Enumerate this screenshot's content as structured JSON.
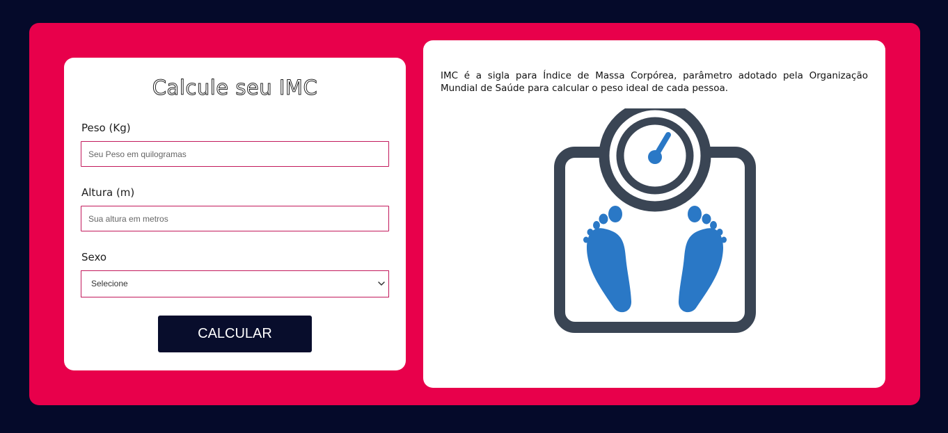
{
  "form": {
    "title": "Calcule seu IMC",
    "weight": {
      "label": "Peso (Kg)",
      "placeholder": "Seu Peso em quilogramas",
      "value": ""
    },
    "height": {
      "label": "Altura (m)",
      "placeholder": "Sua altura em metros",
      "value": ""
    },
    "sex": {
      "label": "Sexo",
      "selected": "Selecione"
    },
    "submit_label": "CALCULAR"
  },
  "info": {
    "description": "IMC é a sigla para Índice de Massa Corpórea, parâmetro adotado pela Organização Mundial de Saúde para calcular o peso ideal de cada pessoa."
  },
  "colors": {
    "page_background": "#050a2a",
    "panel_background": "#e8004b",
    "card_background": "#ffffff",
    "button_background": "#080d2c",
    "input_border": "#c2185b",
    "scale_frame": "#3a4554",
    "scale_accent": "#2a78c6"
  },
  "icons": {
    "scale": "bathroom-scale-icon",
    "select_arrow": "chevron-down-icon"
  }
}
